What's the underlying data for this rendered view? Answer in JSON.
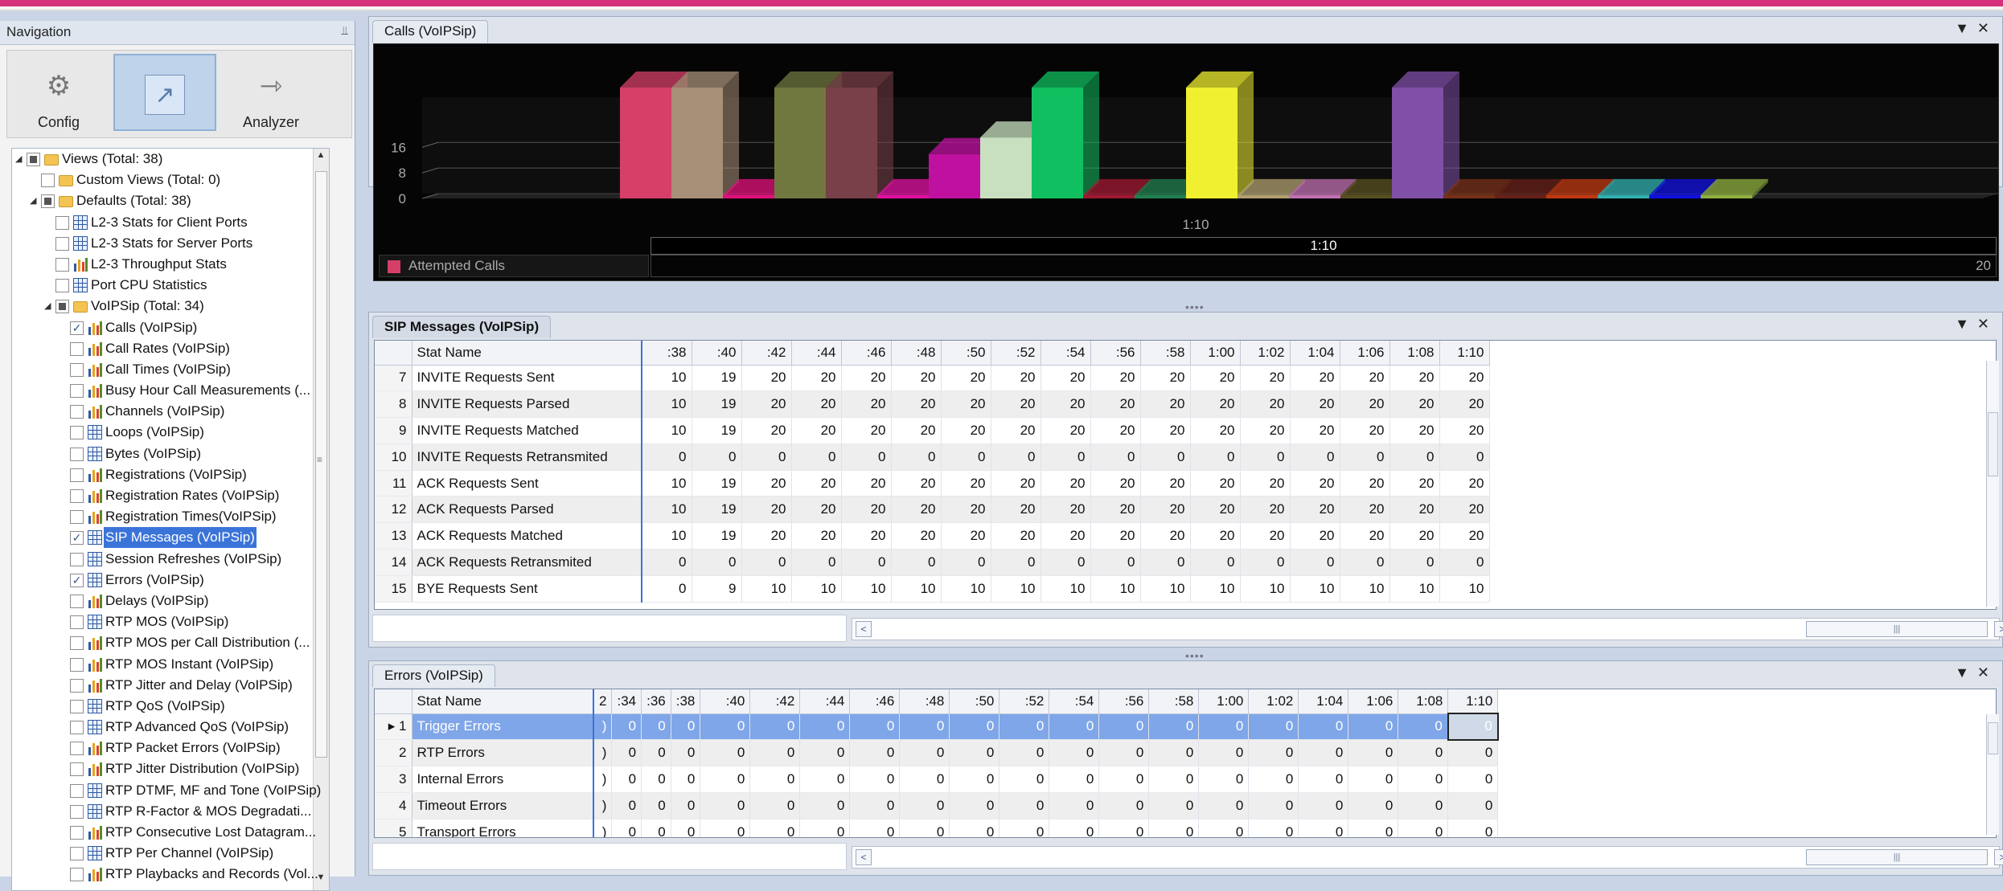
{
  "navigation": {
    "title": "Navigation",
    "tools": [
      {
        "label": "Config",
        "icon": "gear-icon"
      },
      {
        "label": "",
        "icon": "line-chart-icon"
      },
      {
        "label": "Analyzer",
        "icon": "analyzer-icon"
      }
    ],
    "tree": [
      {
        "label": "Views (Total: 38)",
        "level": 0,
        "exp": "open",
        "check": "ind",
        "icon": "folder"
      },
      {
        "label": "Custom Views (Total: 0)",
        "level": 1,
        "exp": "",
        "check": "off",
        "icon": "folder"
      },
      {
        "label": "Defaults (Total: 38)",
        "level": 1,
        "exp": "open",
        "check": "ind",
        "icon": "folder"
      },
      {
        "label": "L2-3 Stats for Client Ports",
        "level": 2,
        "exp": "",
        "check": "off",
        "icon": "grid"
      },
      {
        "label": "L2-3 Stats for Server Ports",
        "level": 2,
        "exp": "",
        "check": "off",
        "icon": "grid"
      },
      {
        "label": "L2-3 Throughput Stats",
        "level": 2,
        "exp": "",
        "check": "off",
        "icon": "bars"
      },
      {
        "label": "Port CPU Statistics",
        "level": 2,
        "exp": "",
        "check": "off",
        "icon": "grid"
      },
      {
        "label": "VoIPSip (Total: 34)",
        "level": 2,
        "exp": "open",
        "check": "ind",
        "icon": "folder"
      },
      {
        "label": "Calls (VoIPSip)",
        "level": 3,
        "exp": "",
        "check": "on",
        "icon": "bars"
      },
      {
        "label": "Call Rates (VoIPSip)",
        "level": 3,
        "exp": "",
        "check": "off",
        "icon": "bars"
      },
      {
        "label": "Call Times (VoIPSip)",
        "level": 3,
        "exp": "",
        "check": "off",
        "icon": "bars"
      },
      {
        "label": "Busy Hour Call Measurements (...",
        "level": 3,
        "exp": "",
        "check": "off",
        "icon": "bars"
      },
      {
        "label": "Channels (VoIPSip)",
        "level": 3,
        "exp": "",
        "check": "off",
        "icon": "bars"
      },
      {
        "label": "Loops (VoIPSip)",
        "level": 3,
        "exp": "",
        "check": "off",
        "icon": "grid"
      },
      {
        "label": "Bytes (VoIPSip)",
        "level": 3,
        "exp": "",
        "check": "off",
        "icon": "grid"
      },
      {
        "label": "Registrations (VoIPSip)",
        "level": 3,
        "exp": "",
        "check": "off",
        "icon": "bars"
      },
      {
        "label": "Registration Rates (VoIPSip)",
        "level": 3,
        "exp": "",
        "check": "off",
        "icon": "bars"
      },
      {
        "label": "Registration Times(VoIPSip)",
        "level": 3,
        "exp": "",
        "check": "off",
        "icon": "bars"
      },
      {
        "label": "SIP Messages (VoIPSip)",
        "level": 3,
        "exp": "",
        "check": "on",
        "icon": "grid",
        "selected": true
      },
      {
        "label": "Session Refreshes (VoIPSip)",
        "level": 3,
        "exp": "",
        "check": "off",
        "icon": "grid"
      },
      {
        "label": "Errors (VoIPSip)",
        "level": 3,
        "exp": "",
        "check": "on",
        "icon": "grid"
      },
      {
        "label": "Delays (VoIPSip)",
        "level": 3,
        "exp": "",
        "check": "off",
        "icon": "bars"
      },
      {
        "label": "RTP MOS (VoIPSip)",
        "level": 3,
        "exp": "",
        "check": "off",
        "icon": "grid"
      },
      {
        "label": "RTP MOS per Call Distribution (...",
        "level": 3,
        "exp": "",
        "check": "off",
        "icon": "bars"
      },
      {
        "label": "RTP MOS Instant (VoIPSip)",
        "level": 3,
        "exp": "",
        "check": "off",
        "icon": "bars"
      },
      {
        "label": "RTP Jitter and Delay (VoIPSip)",
        "level": 3,
        "exp": "",
        "check": "off",
        "icon": "bars"
      },
      {
        "label": "RTP QoS (VoIPSip)",
        "level": 3,
        "exp": "",
        "check": "off",
        "icon": "grid"
      },
      {
        "label": "RTP Advanced QoS (VoIPSip)",
        "level": 3,
        "exp": "",
        "check": "off",
        "icon": "grid"
      },
      {
        "label": "RTP Packet Errors (VoIPSip)",
        "level": 3,
        "exp": "",
        "check": "off",
        "icon": "bars"
      },
      {
        "label": "RTP Jitter Distribution (VoIPSip)",
        "level": 3,
        "exp": "",
        "check": "off",
        "icon": "bars"
      },
      {
        "label": "RTP DTMF, MF and Tone (VoIPSip)",
        "level": 3,
        "exp": "",
        "check": "off",
        "icon": "grid"
      },
      {
        "label": "RTP R-Factor & MOS Degradati...",
        "level": 3,
        "exp": "",
        "check": "off",
        "icon": "grid"
      },
      {
        "label": "RTP Consecutive Lost Datagram...",
        "level": 3,
        "exp": "",
        "check": "off",
        "icon": "bars"
      },
      {
        "label": "RTP Per Channel (VoIPSip)",
        "level": 3,
        "exp": "",
        "check": "off",
        "icon": "grid"
      },
      {
        "label": "RTP Playbacks and Records (Vol...",
        "level": 3,
        "exp": "",
        "check": "off",
        "icon": "bars"
      }
    ]
  },
  "calls_pane": {
    "tab": "Calls (VoIPSip)",
    "legend_label": "Attempted Calls",
    "legend_color": "#d64068",
    "range_label": "1:10",
    "scroll_right_label": "20"
  },
  "chart_data": {
    "type": "bar",
    "title": "",
    "xlabel": "1:10",
    "ylabel": "",
    "ylim": [
      0,
      24
    ],
    "yticks": [
      0,
      8,
      16
    ],
    "series_colors": [
      "#d64068",
      "#a89078",
      "#e0107a",
      "#707840",
      "#784048",
      "#e010a0",
      "#c010a0",
      "#c8e0c0",
      "#10c060",
      "#a01830",
      "#208050",
      "#f0f030",
      "#b0a070",
      "#c070b0",
      "#585020",
      "#8050a8",
      "#783018",
      "#682018",
      "#c03810",
      "#30b0b0",
      "#1010e0",
      "#90b040"
    ],
    "values": [
      20,
      20,
      0,
      20,
      20,
      0,
      8,
      11,
      20,
      0,
      0,
      20,
      0,
      0,
      0,
      20,
      0,
      0,
      0,
      0,
      0,
      0
    ]
  },
  "sip_pane": {
    "tab": "SIP Messages (VoIPSip)",
    "columns": [
      "Stat Name",
      ":38",
      ":40",
      ":42",
      ":44",
      ":46",
      ":48",
      ":50",
      ":52",
      ":54",
      ":56",
      ":58",
      "1:00",
      "1:02",
      "1:04",
      "1:06",
      "1:08",
      "1:10"
    ],
    "rows": [
      {
        "n": "7",
        "name": "INVITE Requests Sent",
        "v": [
          "10",
          "19",
          "20",
          "20",
          "20",
          "20",
          "20",
          "20",
          "20",
          "20",
          "20",
          "20",
          "20",
          "20",
          "20",
          "20",
          "20"
        ]
      },
      {
        "n": "8",
        "name": "INVITE Requests Parsed",
        "v": [
          "10",
          "19",
          "20",
          "20",
          "20",
          "20",
          "20",
          "20",
          "20",
          "20",
          "20",
          "20",
          "20",
          "20",
          "20",
          "20",
          "20"
        ]
      },
      {
        "n": "9",
        "name": "INVITE Requests Matched",
        "v": [
          "10",
          "19",
          "20",
          "20",
          "20",
          "20",
          "20",
          "20",
          "20",
          "20",
          "20",
          "20",
          "20",
          "20",
          "20",
          "20",
          "20"
        ]
      },
      {
        "n": "10",
        "name": "INVITE Requests Retransmited",
        "v": [
          "0",
          "0",
          "0",
          "0",
          "0",
          "0",
          "0",
          "0",
          "0",
          "0",
          "0",
          "0",
          "0",
          "0",
          "0",
          "0",
          "0"
        ]
      },
      {
        "n": "11",
        "name": "ACK Requests Sent",
        "v": [
          "10",
          "19",
          "20",
          "20",
          "20",
          "20",
          "20",
          "20",
          "20",
          "20",
          "20",
          "20",
          "20",
          "20",
          "20",
          "20",
          "20"
        ]
      },
      {
        "n": "12",
        "name": "ACK Requests Parsed",
        "v": [
          "10",
          "19",
          "20",
          "20",
          "20",
          "20",
          "20",
          "20",
          "20",
          "20",
          "20",
          "20",
          "20",
          "20",
          "20",
          "20",
          "20"
        ]
      },
      {
        "n": "13",
        "name": "ACK Requests Matched",
        "v": [
          "10",
          "19",
          "20",
          "20",
          "20",
          "20",
          "20",
          "20",
          "20",
          "20",
          "20",
          "20",
          "20",
          "20",
          "20",
          "20",
          "20"
        ]
      },
      {
        "n": "14",
        "name": "ACK Requests Retransmited",
        "v": [
          "0",
          "0",
          "0",
          "0",
          "0",
          "0",
          "0",
          "0",
          "0",
          "0",
          "0",
          "0",
          "0",
          "0",
          "0",
          "0",
          "0"
        ]
      },
      {
        "n": "15",
        "name": "BYE Requests Sent",
        "v": [
          "0",
          "9",
          "10",
          "10",
          "10",
          "10",
          "10",
          "10",
          "10",
          "10",
          "10",
          "10",
          "10",
          "10",
          "10",
          "10",
          "10"
        ]
      }
    ]
  },
  "errors_pane": {
    "tab": "Errors (VoIPSip)",
    "columns": [
      "Stat Name",
      "2",
      ":34",
      ":36",
      ":38",
      ":40",
      ":42",
      ":44",
      ":46",
      ":48",
      ":50",
      ":52",
      ":54",
      ":56",
      ":58",
      "1:00",
      "1:02",
      "1:04",
      "1:06",
      "1:08",
      "1:10"
    ],
    "rows": [
      {
        "n": "1",
        "name": "Trigger Errors",
        "v": [
          ")",
          "0",
          "0",
          "0",
          "0",
          "0",
          "0",
          "0",
          "0",
          "0",
          "0",
          "0",
          "0",
          "0",
          "0",
          "0",
          "0",
          "0",
          "0",
          "0"
        ],
        "selected": true
      },
      {
        "n": "2",
        "name": "RTP Errors",
        "v": [
          ")",
          "0",
          "0",
          "0",
          "0",
          "0",
          "0",
          "0",
          "0",
          "0",
          "0",
          "0",
          "0",
          "0",
          "0",
          "0",
          "0",
          "0",
          "0",
          "0"
        ]
      },
      {
        "n": "3",
        "name": "Internal Errors",
        "v": [
          ")",
          "0",
          "0",
          "0",
          "0",
          "0",
          "0",
          "0",
          "0",
          "0",
          "0",
          "0",
          "0",
          "0",
          "0",
          "0",
          "0",
          "0",
          "0",
          "0"
        ]
      },
      {
        "n": "4",
        "name": "Timeout Errors",
        "v": [
          ")",
          "0",
          "0",
          "0",
          "0",
          "0",
          "0",
          "0",
          "0",
          "0",
          "0",
          "0",
          "0",
          "0",
          "0",
          "0",
          "0",
          "0",
          "0",
          "0"
        ]
      },
      {
        "n": "5",
        "name": "Transport Errors",
        "v": [
          ")",
          "0",
          "0",
          "0",
          "0",
          "0",
          "0",
          "0",
          "0",
          "0",
          "0",
          "0",
          "0",
          "0",
          "0",
          "0",
          "0",
          "0",
          "0",
          "0"
        ]
      }
    ]
  }
}
